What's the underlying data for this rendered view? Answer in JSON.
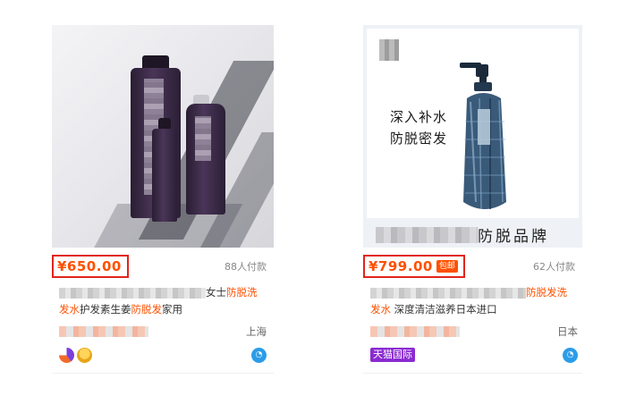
{
  "products": [
    {
      "price": "¥650.00",
      "sales": "88人付款",
      "title_plain_1": "女士",
      "title_hl_1": "防脱洗",
      "title_hl_2": "发水",
      "title_plain_2": "护发素生姜",
      "title_hl_3": "防脱发",
      "title_plain_3": "家用",
      "location": "上海"
    },
    {
      "price": "¥799.00",
      "badge": "包邮",
      "sales": "62人付款",
      "ad_line_1": "深入补水",
      "ad_line_2": "防脱密发",
      "band_text": "防脱品牌",
      "title_hl_1": "防脱发洗",
      "title_hl_2": "发水",
      "title_plain_1": "深度清洁滋养日本进口",
      "location": "日本",
      "tag": "天猫国际"
    }
  ],
  "colors": {
    "price": "#ff5000",
    "highlight_box": "#e1251b",
    "tmall_tag": "#8a2bd1",
    "wangwang": "#2c9ce8"
  },
  "icons": [
    "chat-bubble-icon",
    "gold-medal-icon",
    "wangwang-chat-icon"
  ]
}
